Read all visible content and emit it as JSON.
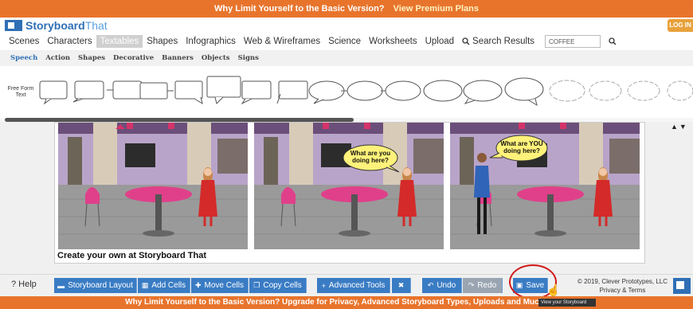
{
  "promo_top": {
    "text": "Why Limit Yourself to the Basic Version?",
    "link": "View Premium Plans"
  },
  "brand": {
    "name_a": "Storyboard",
    "name_b": "That",
    "login_label": "LOG IN"
  },
  "nav": {
    "items": [
      "Scenes",
      "Characters",
      "Textables",
      "Shapes",
      "Infographics",
      "Web & Wireframes",
      "Science",
      "Worksheets",
      "Upload"
    ],
    "active": "Textables",
    "search_results_label": "Search Results",
    "search_value": "COFFEE"
  },
  "subnav": {
    "items": [
      "Speech",
      "Action",
      "Shapes",
      "Decorative",
      "Banners",
      "Objects",
      "Signs"
    ],
    "active": "Speech"
  },
  "shapes": {
    "freeform_label": "Free Form Text"
  },
  "cells": {
    "c2_bubble_line1": "What are you",
    "c2_bubble_line2": "doing here?",
    "c3_bubble_line1": "What are YOU",
    "c3_bubble_line2": "doing here?"
  },
  "caption": "Create your own at Storyboard That",
  "toolbar": {
    "help": "? Help",
    "storyboard_layout": "Storyboard Layout",
    "add_cells": "Add Cells",
    "move_cells": "Move Cells",
    "copy_cells": "Copy Cells",
    "advanced_tools": "Advanced Tools",
    "undo": "Undo",
    "redo": "Redo",
    "save": "Save",
    "copyright_line1": "© 2019, Clever Prototypes, LLC",
    "copyright_line2": "Privacy & Terms",
    "tooltip": "View your Storyboard"
  },
  "promo_bottom": "Why Limit Yourself to the Basic Version? Upgrade for Privacy, Advanced Storyboard Types, Uploads and Much More!",
  "colors": {
    "accent_orange": "#e8742c",
    "brand_blue": "#2f6fb5",
    "button_blue": "#3a7cc4",
    "highlight_red": "#d21a1a"
  }
}
